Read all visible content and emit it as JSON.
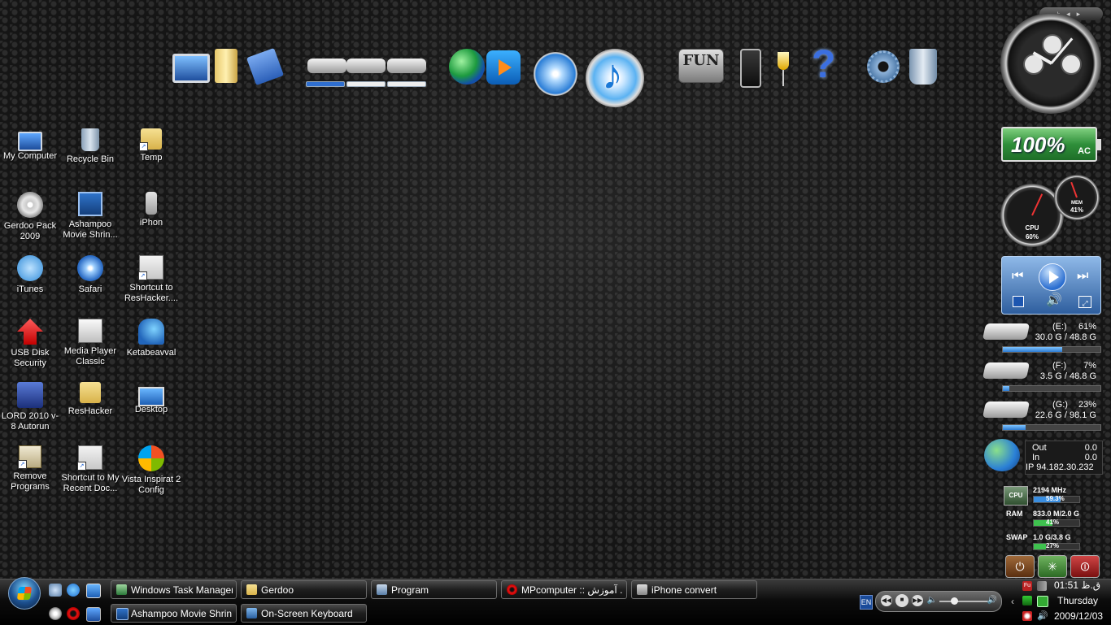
{
  "desktop_icons": [
    {
      "label": "My Computer",
      "icon": "computer-icon"
    },
    {
      "label": "Recycle Bin",
      "icon": "recycle-bin-icon"
    },
    {
      "label": "Temp",
      "icon": "folder-icon"
    },
    {
      "label": "Gerdoo Pack 2009",
      "icon": "disc-icon"
    },
    {
      "label": "Ashampoo Movie Shrin...",
      "icon": "film-icon"
    },
    {
      "label": "iPhon",
      "icon": "iphone-icon"
    },
    {
      "label": "iTunes",
      "icon": "itunes-icon"
    },
    {
      "label": "Safari",
      "icon": "safari-icon"
    },
    {
      "label": "Shortcut to ResHacker....",
      "icon": "reshacker-icon"
    },
    {
      "label": "USB Disk Security",
      "icon": "usb-disk-security-icon"
    },
    {
      "label": "Media Player Classic",
      "icon": "media-player-classic-icon"
    },
    {
      "label": "Ketabeavval",
      "icon": "ketabeavval-icon"
    },
    {
      "label": "LORD 2010 v-8 Autorun",
      "icon": "autorun-icon"
    },
    {
      "label": "ResHacker",
      "icon": "folder-icon"
    },
    {
      "label": "Desktop",
      "icon": "desktop-icon"
    },
    {
      "label": "Remove Programs",
      "icon": "remove-programs-icon"
    },
    {
      "label": "Shortcut to My Recent Doc...",
      "icon": "recent-documents-icon"
    },
    {
      "label": "Vista Inspirat 2 Config",
      "icon": "vista-inspirat-icon"
    }
  ],
  "dock": {
    "fun_label": "FUN",
    "help_glyph": "?"
  },
  "gadgets": {
    "battery": {
      "percent": "100%",
      "source": "AC"
    },
    "gauges": {
      "cpu_label": "CPU",
      "cpu_value": "60%",
      "mem_label": "MEM",
      "mem_value": "41%"
    },
    "drives": [
      {
        "name": "(E:)",
        "percent": "61%",
        "size": "30.0 G / 48.8 G",
        "fill": 0.61
      },
      {
        "name": "(F:)",
        "percent": "7%",
        "size": "3.5 G / 48.8 G",
        "fill": 0.07
      },
      {
        "name": "(G:)",
        "percent": "23%",
        "size": "22.6 G / 98.1 G",
        "fill": 0.23
      }
    ],
    "network": {
      "out_label": "Out",
      "out_value": "0.0",
      "in_label": "In",
      "in_value": "0.0",
      "ip": "IP 94.182.30.232"
    },
    "system": {
      "cpu_chip": "CPU",
      "cpu_value": "2194 MHz",
      "cpu_percent": "59.3%",
      "cpu_fill": 0.593,
      "ram_label": "RAM",
      "ram_value": "833.0 M/2.0 G",
      "ram_percent": "41%",
      "ram_fill": 0.41,
      "swap_label": "SWAP",
      "swap_value": "1.0 G/3.8 G",
      "swap_percent": "27%",
      "swap_fill": 0.27
    }
  },
  "taskbar": {
    "tasks_row1": [
      {
        "label": "Windows Task Manager"
      },
      {
        "label": "Gerdoo"
      },
      {
        "label": "Program"
      },
      {
        "label": "MPcomputer :: آموزش ..."
      },
      {
        "label": "iPhone convert"
      }
    ],
    "tasks_row2": [
      {
        "label": "Ashampoo Movie Shrin..."
      },
      {
        "label": "On-Screen Keyboard"
      }
    ],
    "language": "EN",
    "clock_time": "01:51 ق.ظ",
    "clock_day": "Thursday",
    "clock_date": "2009/12/03"
  }
}
